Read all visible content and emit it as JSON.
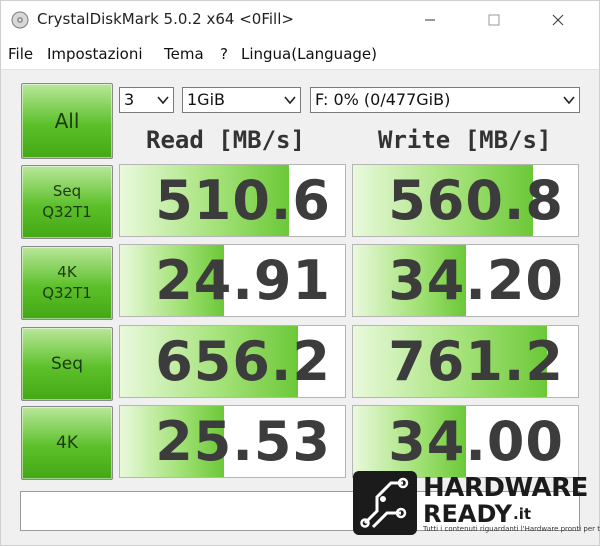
{
  "window": {
    "title": "CrystalDiskMark 5.0.2 x64 <0Fill>"
  },
  "menu": [
    "File",
    "Impostazioni",
    "Tema",
    "?",
    "Lingua(Language)"
  ],
  "controls": {
    "all_label": "All",
    "test_count": "3",
    "test_size": "1GiB",
    "drive": "F: 0% (0/477GiB)"
  },
  "headers": {
    "read": "Read [MB/s]",
    "write": "Write [MB/s]"
  },
  "tests": [
    {
      "label": "Seq\nQ32T1",
      "read": "510.6",
      "write": "560.8",
      "read_fill": 0.75,
      "write_fill": 0.8
    },
    {
      "label": "4K\nQ32T1",
      "read": "24.91",
      "write": "34.20",
      "read_fill": 0.46,
      "write_fill": 0.5
    },
    {
      "label": "Seq",
      "read": "656.2",
      "write": "761.2",
      "read_fill": 0.79,
      "write_fill": 0.86
    },
    {
      "label": "4K",
      "read": "25.53",
      "write": "34.00",
      "read_fill": 0.46,
      "write_fill": 0.5
    }
  ],
  "comment": "",
  "watermark": {
    "brand_top": "HARDWARE",
    "brand_bottom": "READY",
    "brand_suffix": ".it",
    "tagline": "Tutti i contenuti riguardanti l'Hardware pronti per te!"
  },
  "colors": {
    "button_green": "#5cc02a",
    "bar_green": "#6cc838",
    "value_text": "#3c3c3c"
  }
}
